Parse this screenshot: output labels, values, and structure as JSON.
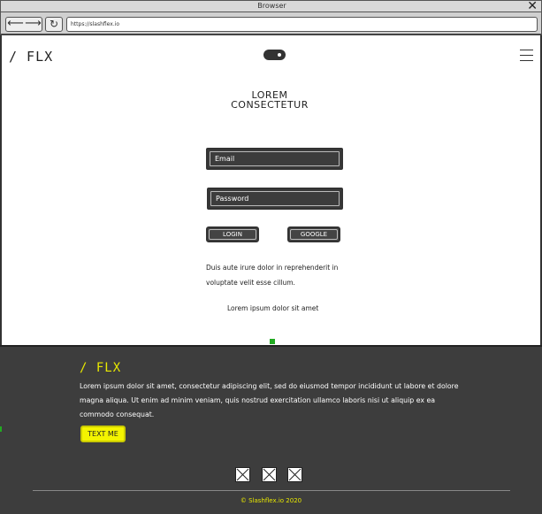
{
  "window": {
    "title": "Browser"
  },
  "toolbar": {
    "back_icon": "left-arrow-icon",
    "forward_icon": "right-arrow-icon",
    "reload_icon": "reload-icon",
    "url": "https://slashflex.io"
  },
  "header": {
    "logo": "/ FLX",
    "toggle_icon": "theme-toggle-icon",
    "menu_icon": "hamburger-menu-icon"
  },
  "login": {
    "heading_line1": "LOREM",
    "heading_line2": "CONSECTETUR",
    "email_label": "Email",
    "password_label": "Password",
    "login_button": "LOGIN",
    "google_button": "GOOGLE",
    "note_line1": "Duis aute irure dolor in reprehenderit in",
    "note_line2": "voluptate velit esse cillum.",
    "link_text": "Lorem ipsum dolor sit amet"
  },
  "footer": {
    "logo": "/ FLX",
    "text": "Lorem ipsum dolor sit amet, consectetur adipiscing elit, sed do eiusmod tempor incididunt ut labore et dolore magna aliqua. Ut enim ad minim veniam, quis nostrud exercitation ullamco laboris nisi ut aliquip ex ea commodo consequat.",
    "cta_label": "TEXT ME",
    "social_icons": [
      "image-placeholder-icon",
      "image-placeholder-icon",
      "image-placeholder-icon"
    ],
    "copyright": "© Slashflex.io 2020"
  },
  "colors": {
    "footer_bg": "#3d3d3d",
    "accent_yellow": "#e8e800",
    "field_bg": "#3a3a3a"
  }
}
